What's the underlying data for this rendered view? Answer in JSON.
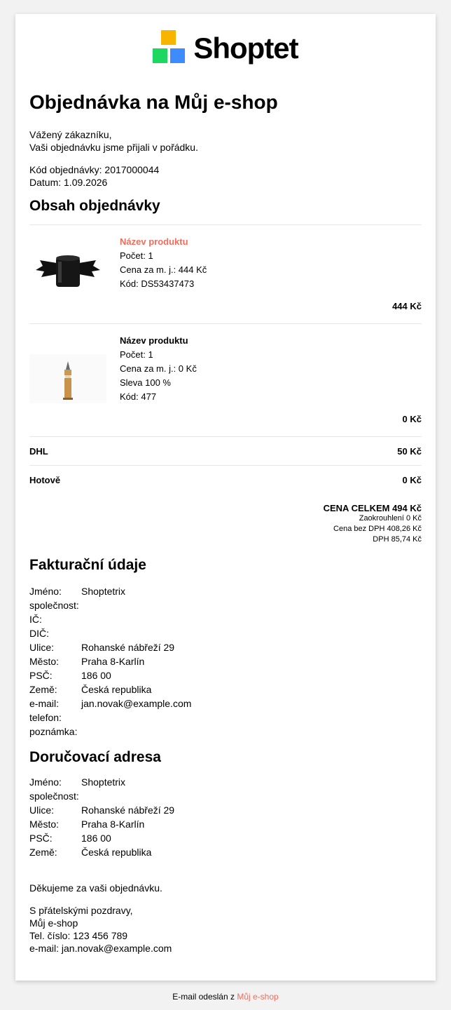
{
  "brand": {
    "name": "Shoptet",
    "colors": {
      "yellow": "#f7b500",
      "green": "#1dd760",
      "blue": "#3d8bfd",
      "accent": "#ee6e5d"
    }
  },
  "title": "Objednávka na Můj e-shop",
  "greeting": [
    "Vážený zákazníku,",
    "Vaši objednávku jsme přijali v pořádku."
  ],
  "order": {
    "code_line": "Kód objednávky: 2017000044",
    "date_line": "Datum: 1.09.2026"
  },
  "contents_heading": "Obsah objednávky",
  "items": [
    {
      "name": "Název produktu",
      "qty": "Počet: 1",
      "unit_price": "Cena za m. j.: 444 Kč",
      "code": "Kód: DS53437473",
      "total": "444 Kč",
      "image": "bat-mug"
    },
    {
      "name": "Název produktu",
      "qty": "Počet: 1",
      "unit_price": "Cena za m. j.: 0 Kč",
      "discount": "Sleva 100 %",
      "code": "Kód: 477",
      "total": "0 Kč",
      "image": "big-ben-figurine"
    }
  ],
  "shipping": {
    "label": "DHL",
    "price": "50 Kč"
  },
  "payment": {
    "label": "Hotově",
    "price": "0 Kč"
  },
  "totals": {
    "total": "CENA CELKEM 494 Kč",
    "rounding": "Zaokrouhlení 0 Kč",
    "without_vat": "Cena bez DPH 408,26 Kč",
    "vat": "DPH 85,74 Kč"
  },
  "billing": {
    "heading": "Fakturační údaje",
    "rows": [
      {
        "k": "Jméno:",
        "v": "Shoptetrix"
      },
      {
        "k": "společnost:",
        "v": ""
      },
      {
        "k": "IČ:",
        "v": ""
      },
      {
        "k": "DIČ:",
        "v": ""
      },
      {
        "k": "Ulice:",
        "v": "Rohanské nábřeží 29"
      },
      {
        "k": "Město:",
        "v": "Praha 8-Karlín"
      },
      {
        "k": "PSČ:",
        "v": "186 00"
      },
      {
        "k": "Země:",
        "v": "Česká republika"
      },
      {
        "k": "e-mail:",
        "v": "jan.novak@example.com"
      },
      {
        "k": "telefon:",
        "v": ""
      },
      {
        "k": "poznámka:",
        "v": ""
      }
    ]
  },
  "delivery": {
    "heading": "Doručovací adresa",
    "rows": [
      {
        "k": "Jméno:",
        "v": "Shoptetrix"
      },
      {
        "k": "společnost:",
        "v": ""
      },
      {
        "k": "Ulice:",
        "v": "Rohanské nábřeží 29"
      },
      {
        "k": "Město:",
        "v": "Praha 8-Karlín"
      },
      {
        "k": "PSČ:",
        "v": "186 00"
      },
      {
        "k": "Země:",
        "v": "Česká republika"
      }
    ]
  },
  "thanks": "Děkujeme za vaši objednávku.",
  "signature": [
    "S přátelskými pozdravy,",
    "Můj e-shop",
    "Tel. číslo: 123 456 789",
    "e-mail: jan.novak@example.com"
  ],
  "footer": {
    "prefix": "E-mail odeslán z ",
    "link": "Můj e-shop"
  }
}
